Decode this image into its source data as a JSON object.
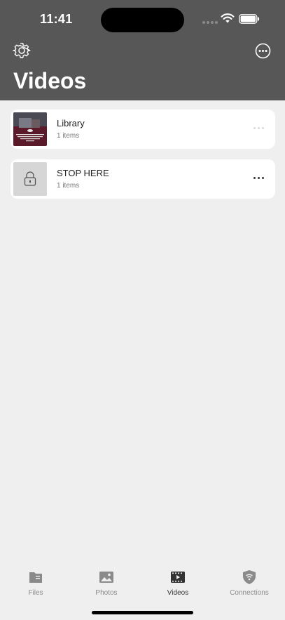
{
  "status_bar": {
    "time": "11:41"
  },
  "header": {
    "title": "Videos"
  },
  "albums": [
    {
      "title": "Library",
      "subtitle": "1 items"
    },
    {
      "title": "STOP HERE",
      "subtitle": "1 items"
    }
  ],
  "tabbar": {
    "tabs": [
      {
        "label": "Files",
        "icon": "folder-icon"
      },
      {
        "label": "Photos",
        "icon": "photo-icon"
      },
      {
        "label": "Videos",
        "icon": "film-icon"
      },
      {
        "label": "Connections",
        "icon": "shield-wifi-icon"
      }
    ],
    "active": "Videos"
  },
  "colors": {
    "header": "#575757",
    "background": "#efefef",
    "card": "#ffffff"
  }
}
